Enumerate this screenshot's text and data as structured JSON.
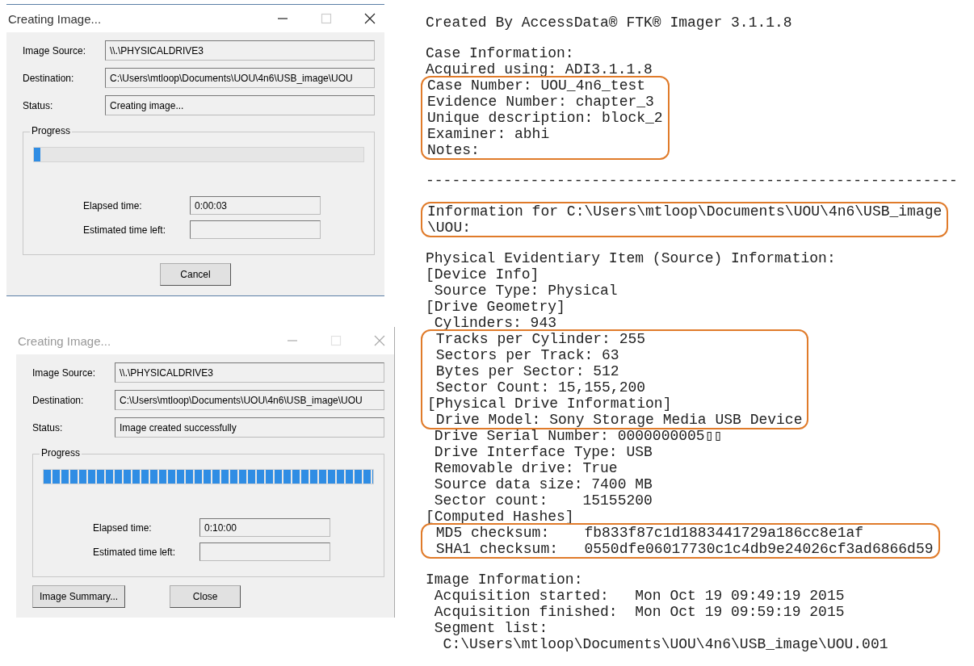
{
  "dialogs": [
    {
      "title": "Creating Image...",
      "active": true,
      "fields": [
        {
          "label": "Image Source:",
          "value": "\\\\.\\PHYSICALDRIVE3"
        },
        {
          "label": "Destination:",
          "value": "C:\\Users\\mtloop\\Documents\\UOU\\4n6\\USB_image\\UOU"
        },
        {
          "label": "Status:",
          "value": "Creating image..."
        }
      ],
      "progress": {
        "legend": "Progress",
        "level": 0.02,
        "elapsed_label": "Elapsed time:",
        "elapsed_value": "0:00:03",
        "remaining_label": "Estimated time left:"
      },
      "buttons": [
        "Cancel"
      ]
    },
    {
      "title": "Creating Image...",
      "active": false,
      "fields": [
        {
          "label": "Image Source:",
          "value": "\\\\.\\PHYSICALDRIVE3"
        },
        {
          "label": "Destination:",
          "value": "C:\\Users\\mtloop\\Documents\\UOU\\4n6\\USB_image\\UOU"
        },
        {
          "label": "Status:",
          "value": "Image created successfully"
        }
      ],
      "progress": {
        "legend": "Progress",
        "level": 1,
        "elapsed_label": "Elapsed time:",
        "elapsed_value": "0:10:00",
        "remaining_label": "Estimated time left:"
      },
      "buttons": [
        "Image Summary...",
        "Close"
      ]
    }
  ],
  "report": {
    "paragraphs": [
      {
        "blocks": [
          {
            "highlighted": false,
            "lines": [
              "Created By AccessData® FTK® Imager 3.1.1.8"
            ]
          }
        ]
      },
      {
        "blocks": [
          {
            "highlighted": false,
            "lines": [
              "Case Information:",
              "Acquired using: ADI3.1.1.8"
            ]
          },
          {
            "highlighted": true,
            "lines": [
              "Case Number: UOU_4n6_test",
              "Evidence Number: chapter_3",
              "Unique description: block_2",
              "Examiner: abhi",
              "Notes:"
            ]
          }
        ]
      },
      {
        "blocks": [
          {
            "highlighted": false,
            "lines": [
              "-------------------------------------------------------------"
            ]
          }
        ]
      },
      {
        "blocks": [
          {
            "highlighted": true,
            "lines": [
              "Information for C:\\Users\\mtloop\\Documents\\UOU\\4n6\\USB_image",
              "\\UOU:"
            ]
          }
        ]
      },
      {
        "blocks": [
          {
            "highlighted": false,
            "lines": [
              "Physical Evidentiary Item (Source) Information:",
              "[Device Info]",
              " Source Type: Physical",
              "[Drive Geometry]",
              " Cylinders: 943"
            ]
          },
          {
            "highlighted": true,
            "lines": [
              " Tracks per Cylinder: 255",
              " Sectors per Track: 63",
              " Bytes per Sector: 512",
              " Sector Count: 15,155,200",
              "[Physical Drive Information]",
              " Drive Model: Sony Storage Media USB Device"
            ]
          },
          {
            "highlighted": false,
            "lines": [
              " Drive Serial Number: 0000000005▯▯",
              " Drive Interface Type: USB",
              " Removable drive: True",
              " Source data size: 7400 MB",
              " Sector count:    15155200",
              "[Computed Hashes]"
            ]
          },
          {
            "highlighted": true,
            "lines": [
              " MD5 checksum:    fb833f87c1d1883441729a186cc8e1af",
              " SHA1 checksum:   0550dfe06017730c1c4db9e24026cf3ad6866d59"
            ]
          }
        ]
      },
      {
        "blocks": [
          {
            "highlighted": false,
            "lines": [
              "Image Information:",
              " Acquisition started:   Mon Oct 19 09:49:19 2015",
              " Acquisition finished:  Mon Oct 19 09:59:19 2015",
              " Segment list:",
              "  C:\\Users\\mtloop\\Documents\\UOU\\4n6\\USB_image\\UOU.001"
            ]
          }
        ]
      }
    ]
  }
}
